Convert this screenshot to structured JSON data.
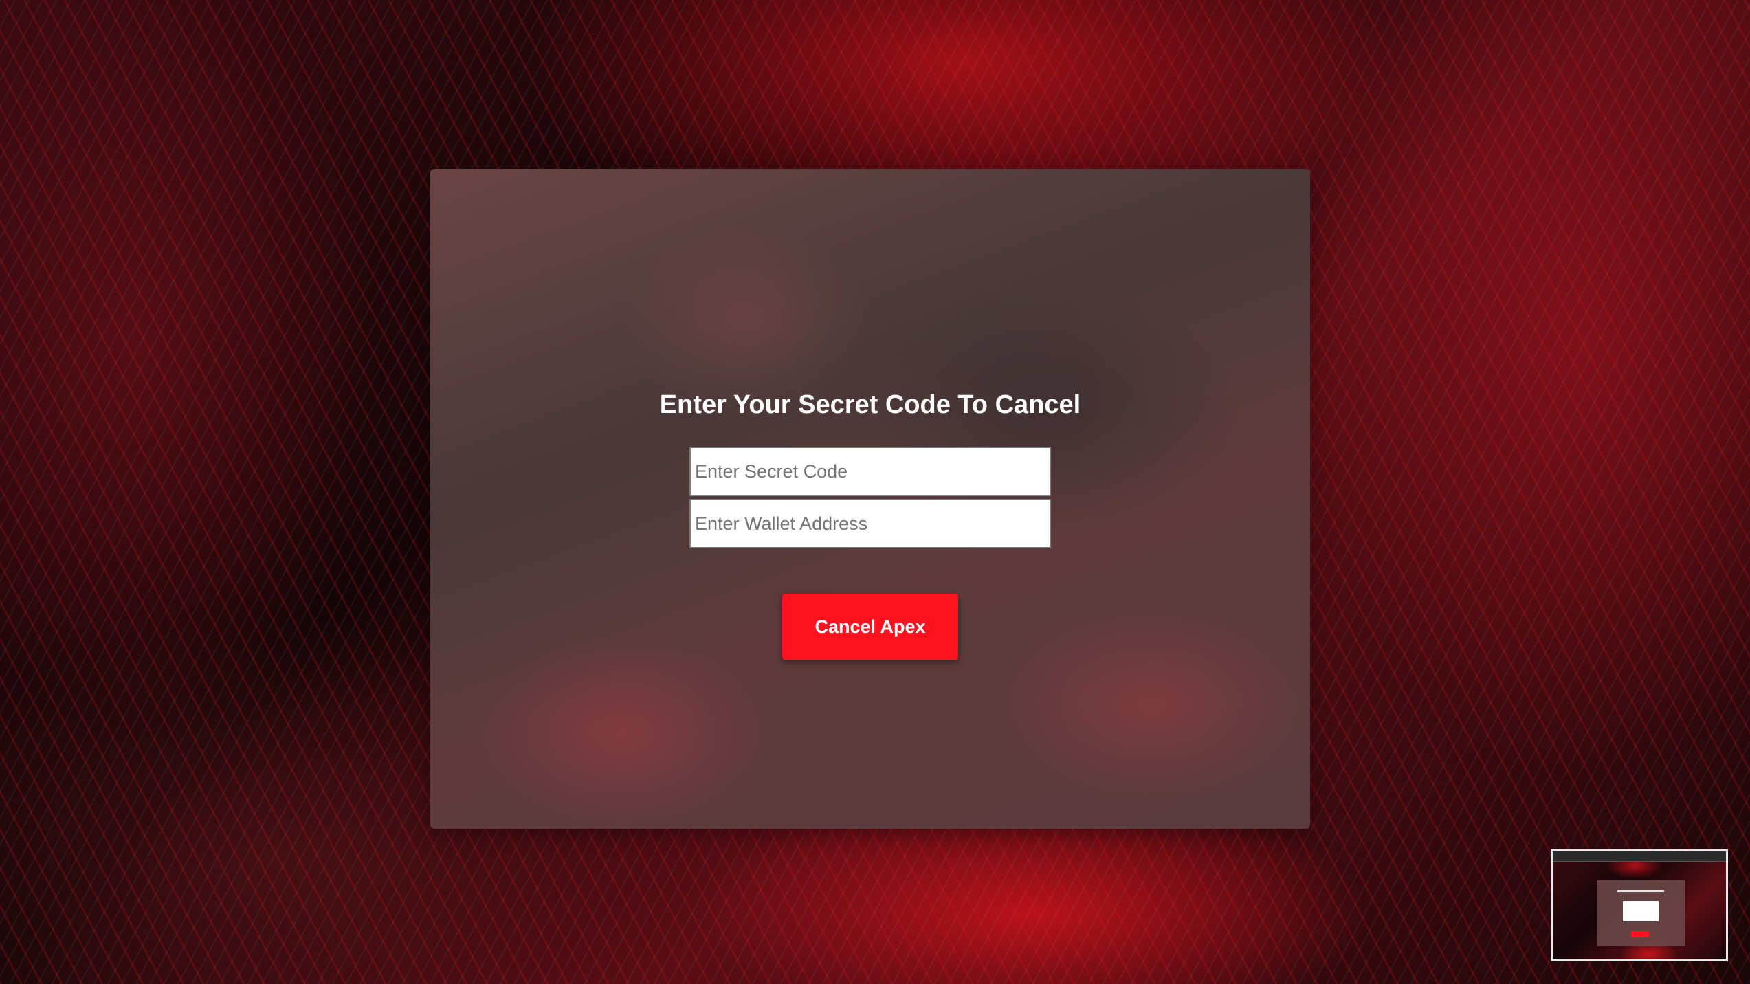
{
  "form": {
    "title": "Enter Your Secret Code To Cancel",
    "secret_code_placeholder": "Enter Secret Code",
    "secret_code_value": "",
    "wallet_address_placeholder": "Enter Wallet Address",
    "wallet_address_value": "",
    "submit_label": "Cancel Apex"
  },
  "colors": {
    "accent_button": "#ff1220",
    "title_text": "#ffffff",
    "card_background": "#5a3b3d"
  },
  "thumbnail": {
    "icon": "window-preview-thumbnail"
  }
}
